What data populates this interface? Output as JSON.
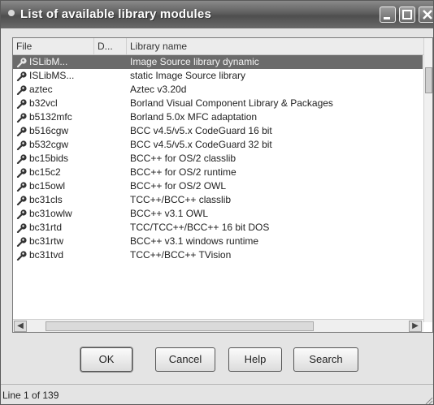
{
  "window": {
    "title": "List of available library modules",
    "minimize_icon": "minimize-icon",
    "maximize_icon": "maximize-icon",
    "close_icon": "close-icon"
  },
  "list": {
    "columns": [
      "File",
      "D...",
      "Library name"
    ],
    "rows": [
      {
        "file": "ISLibM...",
        "name": "Image Source library dynamic",
        "selected": true
      },
      {
        "file": "ISLibMS...",
        "name": "static Image Source library",
        "selected": false
      },
      {
        "file": "aztec",
        "name": "Aztec v3.20d",
        "selected": false
      },
      {
        "file": "b32vcl",
        "name": "Borland Visual Component Library & Packages",
        "selected": false
      },
      {
        "file": "b5132mfc",
        "name": "Borland 5.0x MFC adaptation",
        "selected": false
      },
      {
        "file": "b516cgw",
        "name": "BCC v4.5/v5.x CodeGuard 16 bit",
        "selected": false
      },
      {
        "file": "b532cgw",
        "name": "BCC v4.5/v5.x CodeGuard 32 bit",
        "selected": false
      },
      {
        "file": "bc15bids",
        "name": "BCC++ for OS/2 classlib",
        "selected": false
      },
      {
        "file": "bc15c2",
        "name": "BCC++ for OS/2 runtime",
        "selected": false
      },
      {
        "file": "bc15owl",
        "name": "BCC++ for OS/2 OWL",
        "selected": false
      },
      {
        "file": "bc31cls",
        "name": "TCC++/BCC++ classlib",
        "selected": false
      },
      {
        "file": "bc31owlw",
        "name": "BCC++ v3.1 OWL",
        "selected": false
      },
      {
        "file": "bc31rtd",
        "name": "TCC/TCC++/BCC++ 16 bit DOS",
        "selected": false
      },
      {
        "file": "bc31rtw",
        "name": "BCC++ v3.1 windows runtime",
        "selected": false
      },
      {
        "file": "bc31tvd",
        "name": "TCC++/BCC++ TVision",
        "selected": false
      }
    ],
    "row_icon": "library-module-icon"
  },
  "buttons": {
    "ok": "OK",
    "cancel": "Cancel",
    "help": "Help",
    "search": "Search"
  },
  "status": {
    "text": "Line 1 of 139"
  },
  "colors": {
    "title_bar": "#5e5e5e",
    "selection": "#6b6b6b"
  }
}
